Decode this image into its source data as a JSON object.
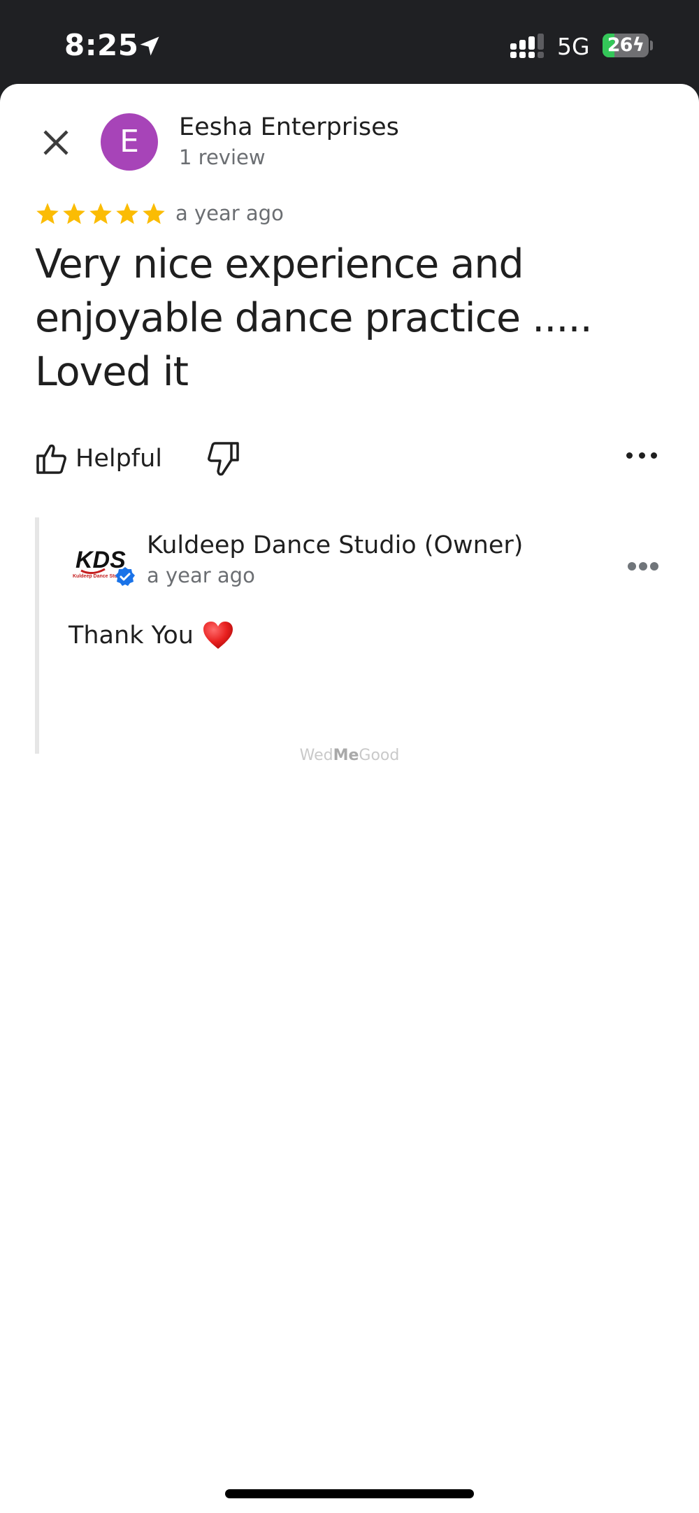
{
  "status_bar": {
    "time": "8:25",
    "location_icon": "location-arrow-icon",
    "signal_icon": "cellular-signal-icon",
    "network": "5G",
    "battery_level": "26",
    "battery_percent": 26,
    "battery_charging": true
  },
  "review": {
    "close_icon": "close-icon",
    "avatar_letter": "E",
    "avatar_color": "#a744b8",
    "reviewer_name": "Eesha Enterprises",
    "review_count": "1 review",
    "rating": 5,
    "rating_max": 5,
    "star_color": "#fbbc04",
    "time": "a year ago",
    "text": "Very nice experience and enjoyable dance practice ..... Loved it",
    "helpful_label": "Helpful",
    "helpful_icon": "thumbs-up-icon",
    "not_helpful_icon": "thumbs-down-icon",
    "more_icon": "more-options-icon"
  },
  "owner_reply": {
    "logo_text": "KDS",
    "logo_subtext": "Kuldeep Dance Stu",
    "verified_icon": "verified-badge-icon",
    "name": "Kuldeep Dance Studio (Owner)",
    "time": "a year ago",
    "text": "Thank You",
    "emoji_icon": "red-heart-icon",
    "more_icon": "more-options-icon"
  },
  "watermark": {
    "part1": "Wed",
    "part2": "Me",
    "part3": "Good"
  }
}
